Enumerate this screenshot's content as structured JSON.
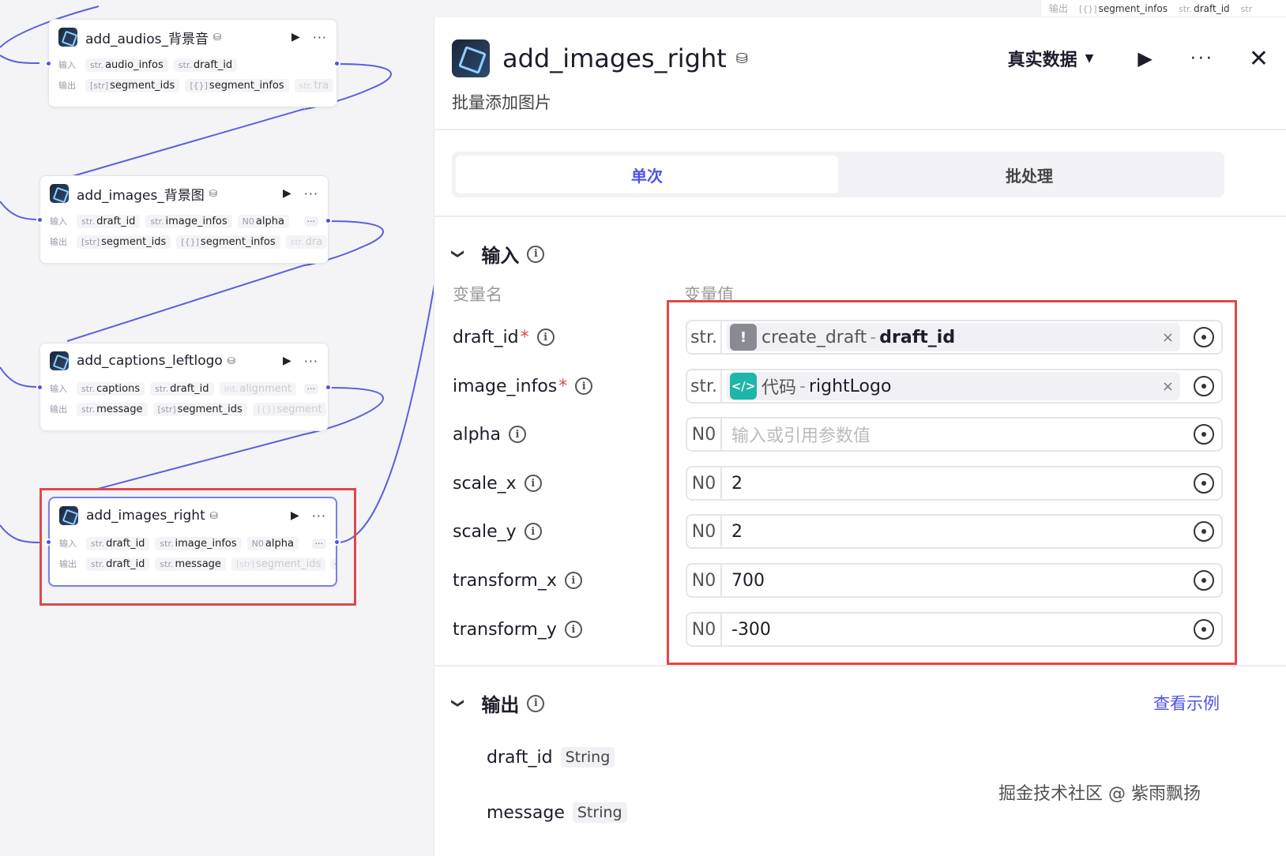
{
  "nodes": [
    {
      "title": "add_audios_背景音",
      "input_label": "输入",
      "output_label": "输出",
      "inputs": [
        {
          "type": "str.",
          "name": "audio_infos"
        },
        {
          "type": "str.",
          "name": "draft_id"
        }
      ],
      "outputs": [
        {
          "type": "[str]",
          "name": "segment_ids"
        },
        {
          "type": "[{}]",
          "name": "segment_infos"
        },
        {
          "type": "str.",
          "name": "tra"
        }
      ]
    },
    {
      "title": "add_images_背景图",
      "input_label": "输入",
      "output_label": "输出",
      "inputs": [
        {
          "type": "str.",
          "name": "draft_id"
        },
        {
          "type": "str.",
          "name": "image_infos"
        },
        {
          "type": "N0",
          "name": "alpha"
        }
      ],
      "outputs": [
        {
          "type": "[str]",
          "name": "segment_ids"
        },
        {
          "type": "[{}]",
          "name": "segment_infos"
        },
        {
          "type": "str.",
          "name": "dra"
        }
      ]
    },
    {
      "title": "add_captions_leftlogo",
      "input_label": "输入",
      "output_label": "输出",
      "inputs": [
        {
          "type": "str.",
          "name": "captions"
        },
        {
          "type": "str.",
          "name": "draft_id"
        },
        {
          "type": "int.",
          "name": "alignment"
        }
      ],
      "outputs": [
        {
          "type": "str.",
          "name": "message"
        },
        {
          "type": "[str]",
          "name": "segment_ids"
        },
        {
          "type": "[{}]",
          "name": "segment"
        }
      ]
    },
    {
      "title": "add_images_right",
      "input_label": "输入",
      "output_label": "输出",
      "inputs": [
        {
          "type": "str.",
          "name": "draft_id"
        },
        {
          "type": "str.",
          "name": "image_infos"
        },
        {
          "type": "N0",
          "name": "alpha"
        }
      ],
      "outputs": [
        {
          "type": "str.",
          "name": "draft_id"
        },
        {
          "type": "str.",
          "name": "message"
        },
        {
          "type": "[str]",
          "name": "segment_ids"
        }
      ]
    }
  ],
  "top_strip": {
    "label": "输出",
    "items": [
      {
        "type": "[{}]",
        "name": "segment_infos"
      },
      {
        "type": "str.",
        "name": "draft_id"
      },
      {
        "type": "str",
        "name": ""
      }
    ]
  },
  "panel": {
    "title": "add_images_right",
    "subtitle": "批量添加图片",
    "mode": "真实数据",
    "tabs": [
      "单次",
      "批处理"
    ],
    "input_section": "输入",
    "col_name": "变量名",
    "col_value": "变量值",
    "params": [
      {
        "name": "draft_id",
        "required": "*",
        "type": "str.",
        "kind": "ref",
        "ref_icon": "!",
        "ref_node": "create_draft",
        "ref_sep": "-",
        "ref_var": "draft_id",
        "clear": "×"
      },
      {
        "name": "image_infos",
        "required": "*",
        "type": "str.",
        "kind": "ref",
        "ref_icon": "</>",
        "ref_node": "代码",
        "ref_sep": "-",
        "ref_var": "rightLogo",
        "clear": "×"
      },
      {
        "name": "alpha",
        "required": "",
        "type": "N0",
        "kind": "empty",
        "placeholder": "输入或引用参数值"
      },
      {
        "name": "scale_x",
        "required": "",
        "type": "N0",
        "kind": "value",
        "value": "2"
      },
      {
        "name": "scale_y",
        "required": "",
        "type": "N0",
        "kind": "value",
        "value": "2"
      },
      {
        "name": "transform_x",
        "required": "",
        "type": "N0",
        "kind": "value",
        "value": "700"
      },
      {
        "name": "transform_y",
        "required": "",
        "type": "N0",
        "kind": "value",
        "value": "-300"
      }
    ],
    "output_section": "输出",
    "view_example": "查看示例",
    "outputs": [
      {
        "name": "draft_id",
        "type": "String"
      },
      {
        "name": "message",
        "type": "String"
      }
    ],
    "watermark": "掘金技术社区 @ 紫雨飘扬"
  },
  "colors": {
    "accent": "#4d53e8",
    "highlight_box": "#e04848",
    "code_icon": "#1db6a8"
  }
}
